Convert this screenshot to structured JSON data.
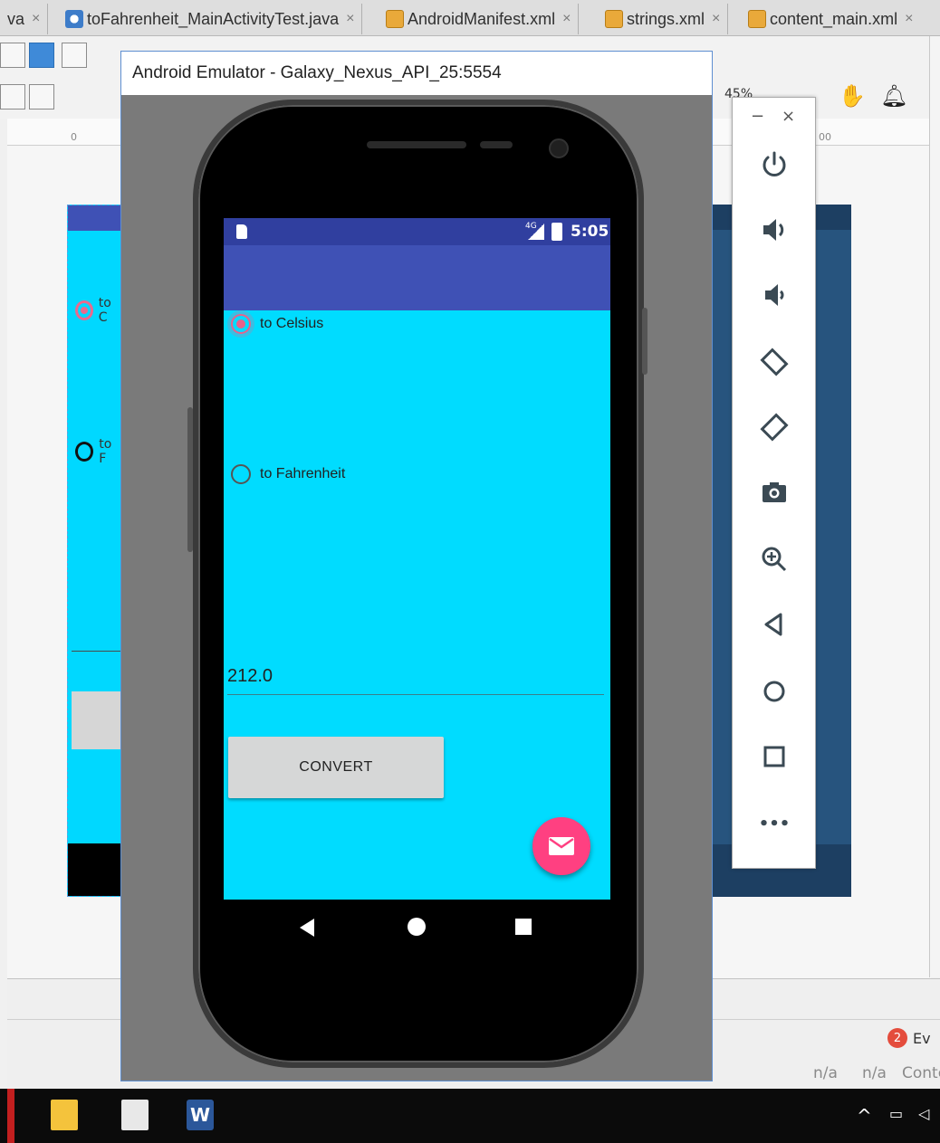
{
  "tabs": [
    {
      "label": "va",
      "close": "×"
    },
    {
      "label": "toFahrenheit_MainActivityTest.java",
      "close": "×"
    },
    {
      "label": "AndroidManifest.xml",
      "close": "×"
    },
    {
      "label": "strings.xml",
      "close": "×"
    },
    {
      "label": "content_main.xml",
      "close": "×"
    }
  ],
  "ruler": {
    "zero": "0",
    "right": "00"
  },
  "zoom": "45%",
  "design_preview": {
    "radio_celsius": "to C",
    "radio_fahrenheit": "to F"
  },
  "emulator": {
    "title": "Android Emulator - Galaxy_Nexus_API_25:5554",
    "status_bar": {
      "network": "4G",
      "time": "5:05"
    },
    "app": {
      "radio_celsius": "to Celsius",
      "radio_fahrenheit": "to Fahrenheit",
      "selected": "to Celsius",
      "value_field": "212.0",
      "convert_button": "CONVERT"
    },
    "controls": {
      "minimize": "−",
      "close": "×",
      "buttons": [
        "power-icon",
        "volume-up-icon",
        "volume-down-icon",
        "rotate-left-icon",
        "rotate-right-icon",
        "camera-icon",
        "zoom-icon",
        "back-icon",
        "home-icon",
        "overview-icon",
        "more-icon"
      ],
      "more_label": "•••"
    }
  },
  "ide_bottom": {
    "event_count": "2",
    "event_label": "Ev",
    "status": [
      "n/a",
      "n/a",
      "Conte"
    ]
  },
  "taskbar": {
    "word_label": "W",
    "tray_chevron": "^"
  },
  "colors": {
    "app_bar": "#3f51b5",
    "status_bar": "#303f9f",
    "screen_bg": "#00dcff",
    "accent": "#ff4081",
    "radio_checked": "#e8628b"
  }
}
